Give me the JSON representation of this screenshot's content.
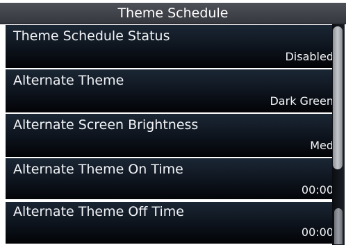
{
  "header": {
    "title": "Theme Schedule"
  },
  "settings": [
    {
      "label": "Theme Schedule Status",
      "value": "Disabled"
    },
    {
      "label": "Alternate Theme",
      "value": "Dark Green"
    },
    {
      "label": "Alternate Screen Brightness",
      "value": "Med"
    },
    {
      "label": "Alternate Theme On Time",
      "value": "00:00"
    },
    {
      "label": "Alternate Theme Off Time",
      "value": "00:00"
    }
  ],
  "colors": {
    "text": "#f2f4f7",
    "title_bar": "#44464e",
    "row_background": "#0d131c",
    "scroll_thumb": "#b0b3b8"
  }
}
